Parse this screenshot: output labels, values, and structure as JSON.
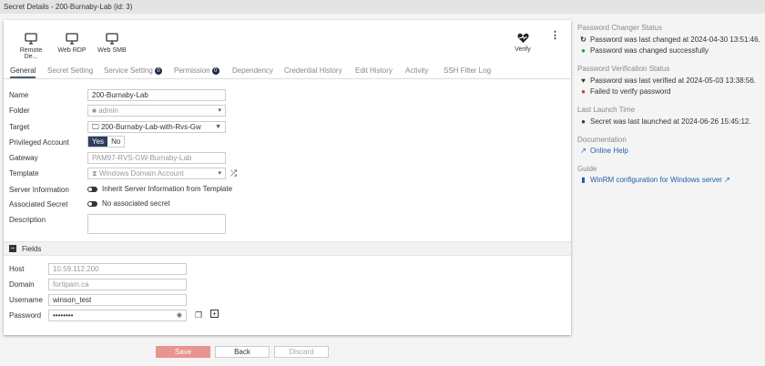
{
  "title": "Secret Details - 200-Burnaby-Lab (id: 3)",
  "toolbar": {
    "launchers": [
      "Remote De...",
      "Web RDP",
      "Web SMB"
    ],
    "verify": "Verify"
  },
  "tabs": [
    "General",
    "Secret Setting",
    "Service Setting",
    "Permission",
    "Dependency",
    "Credential History",
    "Edit History",
    "Activity",
    "SSH Filter Log"
  ],
  "tab_badges": {
    "service_setting": "0",
    "permission": "0"
  },
  "form": {
    "name_label": "Name",
    "name_value": "200-Burnaby-Lab",
    "folder_label": "Folder",
    "folder_value": "admin",
    "target_label": "Target",
    "target_value": "200-Burnaby-Lab-with-Rvs-Gw",
    "privileged_label": "Privileged Account",
    "yes": "Yes",
    "no": "No",
    "gateway_label": "Gateway",
    "gateway_value": "PAM97-RVS-GW-Burnaby-Lab",
    "template_label": "Template",
    "template_value": "Windows Domain Account",
    "server_info_label": "Server Information",
    "server_info_value": "Inherit Server Information from Template",
    "assoc_label": "Associated Secret",
    "assoc_value": "No associated secret",
    "description_label": "Description",
    "description_value": ""
  },
  "fields": {
    "header": "Fields",
    "host_label": "Host",
    "host_value": "10.59.112.200",
    "domain_label": "Domain",
    "domain_value": "fortipam.ca",
    "username_label": "Username",
    "username_value": "winson_test",
    "password_label": "Password",
    "password_value": "••••••••"
  },
  "buttons": {
    "save": "Save",
    "back": "Back",
    "discard": "Discard"
  },
  "right_panel": {
    "changer_header": "Password Changer Status",
    "changer_last": "Password was last changed at 2024-04-30 13:51:46.",
    "changer_result": "Password was changed successfully",
    "verify_header": "Password Verification Status",
    "verify_last": "Password was last verified at 2024-05-03 13:38:56.",
    "verify_result": "Failed to verify password",
    "launch_header": "Last Launch Time",
    "launch_last": "Secret was last launched at 2024-06-26 15:45:12.",
    "doc_header": "Documentation",
    "doc_link": "Online Help",
    "guide_header": "Guide",
    "guide_link": "WinRM configuration for Windows server"
  },
  "colors": {
    "success": "#2a9d3a",
    "error": "#d9342b",
    "link": "#1d5fa8",
    "save": "#e8948f",
    "yes": "#2c3e5c"
  }
}
